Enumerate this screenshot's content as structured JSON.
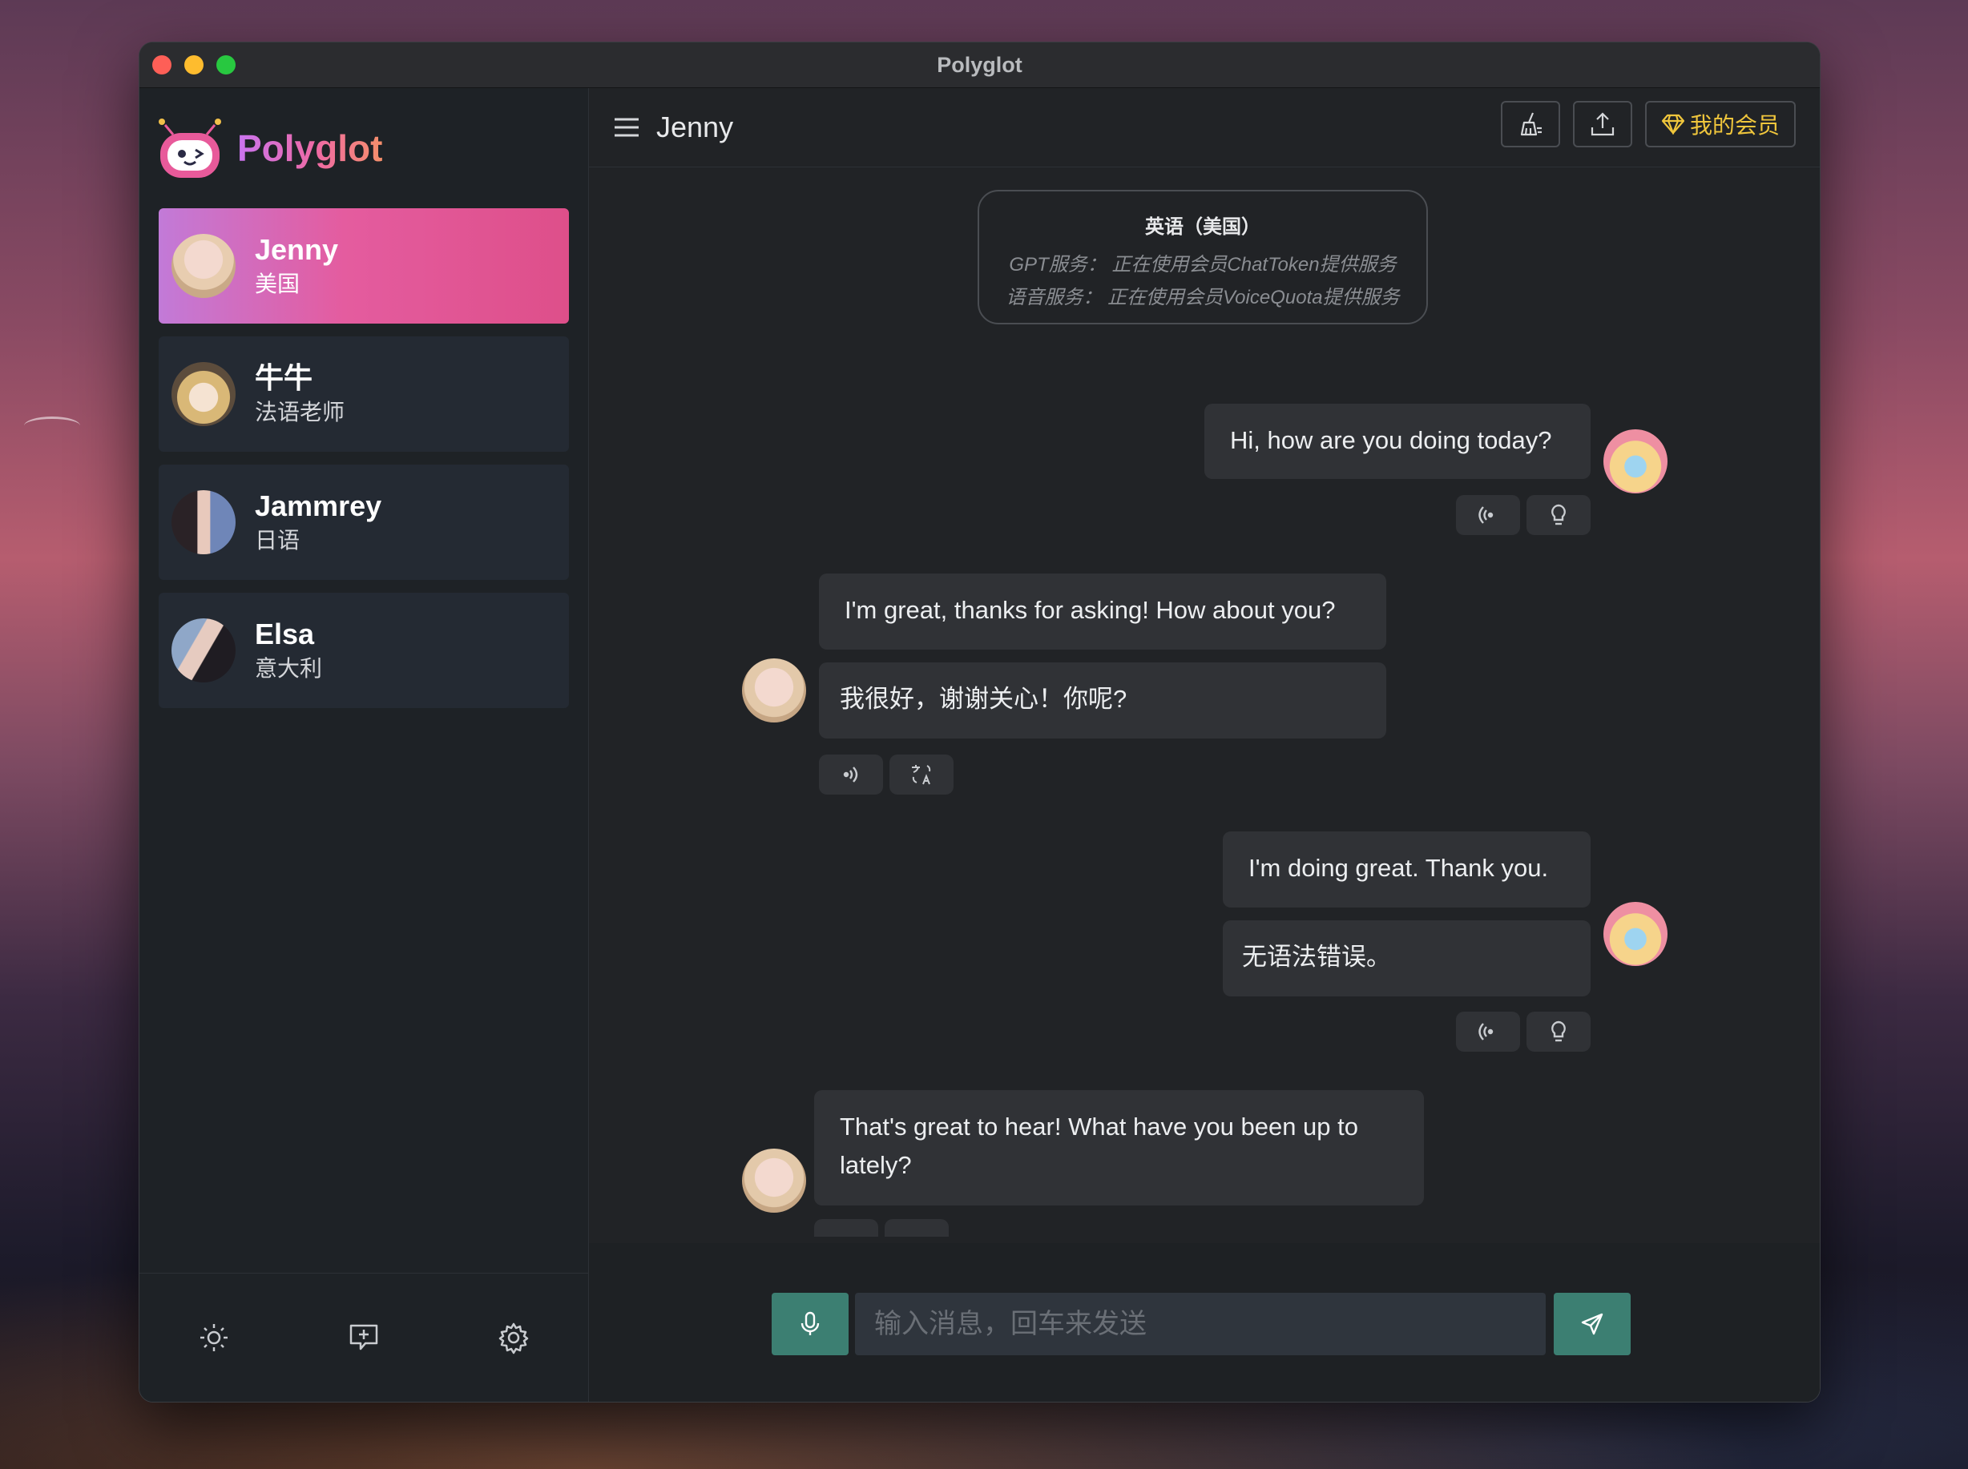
{
  "window": {
    "title": "Polyglot"
  },
  "brand": {
    "name": "Polyglot"
  },
  "contacts": [
    {
      "name": "Jenny",
      "subtitle": "美国",
      "active": true
    },
    {
      "name": "牛牛",
      "subtitle": "法语老师",
      "active": false
    },
    {
      "name": "Jammrey",
      "subtitle": "日语",
      "active": false
    },
    {
      "name": "Elsa",
      "subtitle": "意大利",
      "active": false
    }
  ],
  "sidebar_footer": {
    "icons": [
      "sun-icon",
      "add-chat-icon",
      "gear-icon"
    ]
  },
  "header": {
    "title": "Jenny",
    "vip_label": "我的会员"
  },
  "info_card": {
    "title": "英语（美国）",
    "gpt_line": "GPT服务：  正在使用会员ChatToken提供服务",
    "voice_line": "语音服务：  正在使用会员VoiceQuota提供服务"
  },
  "messages": [
    {
      "from": "user",
      "text": "Hi, how are you doing today?"
    },
    {
      "from": "bot",
      "text": "I'm great, thanks for asking! How about you?",
      "translation": "我很好，谢谢关心！你呢?"
    },
    {
      "from": "user",
      "text": "I'm doing great. Thank you.",
      "grammar": "无语法错误。"
    },
    {
      "from": "bot",
      "text": "That's great to hear! What have you been up to lately?"
    }
  ],
  "composer": {
    "placeholder": "输入消息，回车来发送"
  },
  "colors": {
    "accent": "#3c7f72",
    "vip": "#f0c63c",
    "active_gradient_start": "#c27ad8",
    "active_gradient_end": "#de4f8a"
  }
}
